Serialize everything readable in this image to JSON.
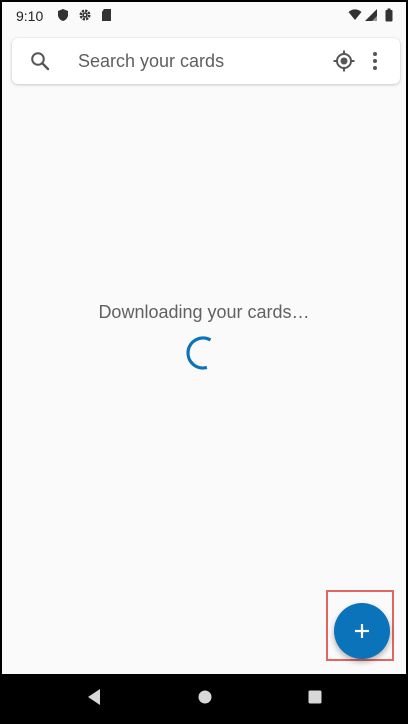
{
  "status_bar": {
    "time": "9:10",
    "left_icons": [
      "shield-icon",
      "gear-icon",
      "sd-card-icon"
    ],
    "right_icons": [
      "wifi-icon",
      "cell-signal-icon",
      "battery-icon"
    ]
  },
  "search": {
    "placeholder": "Search your cards",
    "value": "",
    "icons": [
      "search-icon",
      "location-target-icon",
      "more-vert-icon"
    ]
  },
  "main": {
    "loading_text": "Downloading your cards…"
  },
  "fab": {
    "icon": "plus-icon",
    "color": "#0b73ba",
    "highlight_color": "#e0675f"
  },
  "nav_bar": {
    "icons": [
      "back-icon",
      "home-icon",
      "recents-icon"
    ]
  },
  "colors": {
    "accent": "#0b73ba",
    "background": "#fafafa"
  }
}
